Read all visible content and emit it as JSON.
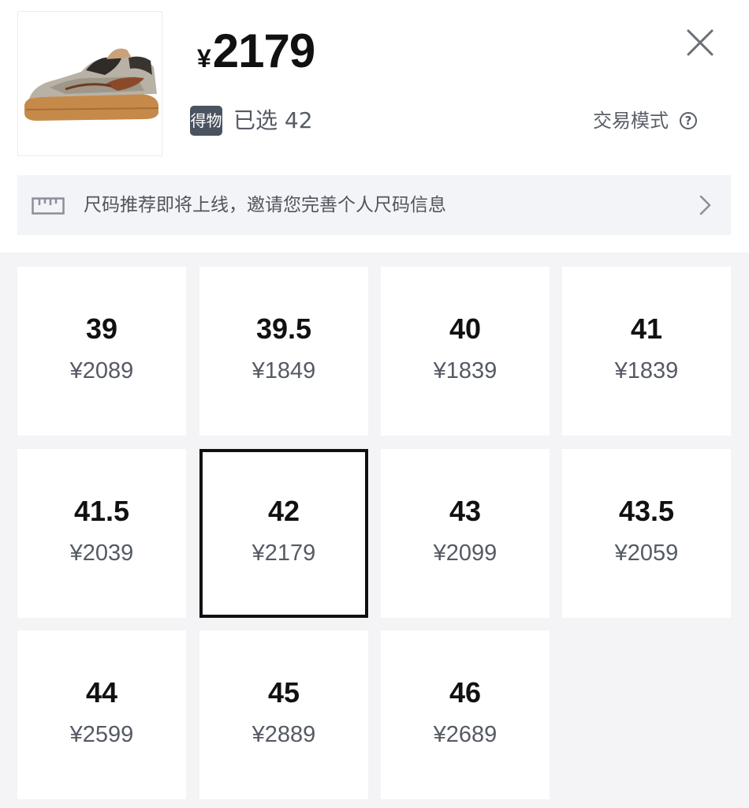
{
  "product": {
    "image_icon": "sneaker-thumbnail",
    "price_symbol": "¥",
    "price_value": "2179",
    "brand_badge": "得物",
    "selected_text": "已选 42",
    "trade_mode_label": "交易模式",
    "help_symbol": "?"
  },
  "banner": {
    "icon": "ruler-icon",
    "text": "尺码推荐即将上线，邀请您完善个人尺码信息"
  },
  "sizes": [
    {
      "size": "39",
      "price": "¥2089"
    },
    {
      "size": "39.5",
      "price": "¥1849"
    },
    {
      "size": "40",
      "price": "¥1839"
    },
    {
      "size": "41",
      "price": "¥1839"
    },
    {
      "size": "41.5",
      "price": "¥2039"
    },
    {
      "size": "42",
      "price": "¥2179",
      "selected": true
    },
    {
      "size": "43",
      "price": "¥2099"
    },
    {
      "size": "43.5",
      "price": "¥2059"
    },
    {
      "size": "44",
      "price": "¥2599"
    },
    {
      "size": "45",
      "price": "¥2889"
    },
    {
      "size": "46",
      "price": "¥2689"
    }
  ],
  "colors": {
    "selected_border": "#111111",
    "grid_background": "#f4f4f6",
    "banner_background": "#f3f4f8",
    "badge_background": "#4a5360"
  }
}
